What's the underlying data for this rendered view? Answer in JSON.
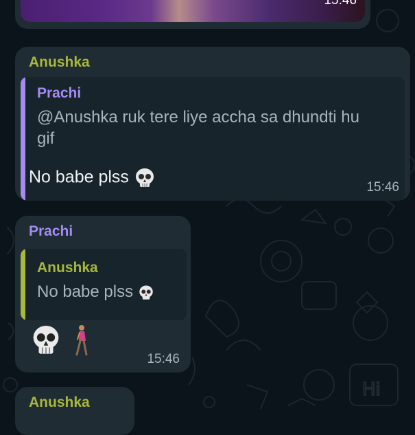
{
  "colors": {
    "background": "#0b141a",
    "bubble": "#1f2c34",
    "quote_bg": "#18242c",
    "name_anushka": "#a8b83c",
    "name_prachi": "#a58bf0",
    "timestamp": "#aab4ba"
  },
  "image_message": {
    "timestamp": "15:46"
  },
  "messages": [
    {
      "sender": "Anushka",
      "reply": {
        "name": "Prachi",
        "line1": "@Anushka ruk tere liye accha sa dhundti hu",
        "line2": "gif"
      },
      "text": "No babe plss",
      "emoji": "skull-icon",
      "timestamp": "15:46"
    },
    {
      "sender": "Prachi",
      "reply": {
        "name": "Anushka",
        "text": "No babe plss",
        "emoji": "skull-icon"
      },
      "emojis": [
        "skull-icon",
        "person-walking-icon"
      ],
      "timestamp": "15:46"
    },
    {
      "sender": "Anushka"
    }
  ]
}
